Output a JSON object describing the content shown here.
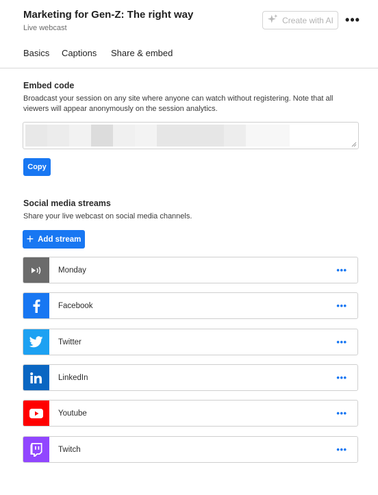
{
  "header": {
    "title": "Marketing for Gen-Z: The right way",
    "subtitle": "Live webcast",
    "ai_button_label": "Create with AI",
    "more_label": "•••"
  },
  "tabs": [
    {
      "label": "Basics"
    },
    {
      "label": "Captions"
    },
    {
      "label": "Share & embed",
      "active": true
    }
  ],
  "embed": {
    "title": "Embed code",
    "description_line1": "Broadcast your session on any site where anyone can watch without registering. Note that all",
    "description_line2": "viewers will appear anonymously on the session analytics.",
    "copy_label": "Copy"
  },
  "social": {
    "title": "Social media streams",
    "description": "Share your live webcast on social media channels.",
    "add_label": "Add stream",
    "streams": [
      {
        "name": "Monday",
        "icon": "monday-icon",
        "color": "#6b6b6b"
      },
      {
        "name": "Facebook",
        "icon": "facebook-icon",
        "color": "#1877f2"
      },
      {
        "name": "Twitter",
        "icon": "twitter-icon",
        "color": "#1da1f2"
      },
      {
        "name": "LinkedIn",
        "icon": "linkedin-icon",
        "color": "#0a66c2"
      },
      {
        "name": "Youtube",
        "icon": "youtube-icon",
        "color": "#ff0000"
      },
      {
        "name": "Twitch",
        "icon": "twitch-icon",
        "color": "#9146ff"
      }
    ],
    "menu_label": "•••"
  },
  "colors": {
    "accent": "#1877f2",
    "tab_underline": "#f6a623"
  }
}
